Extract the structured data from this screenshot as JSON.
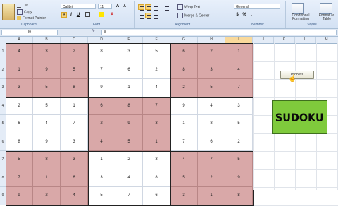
{
  "ribbon": {
    "clipboard": {
      "cut": "Cut",
      "copy": "Copy",
      "format_painter": "Format Painter",
      "label": "Clipboard"
    },
    "font": {
      "name": "Calibri",
      "size": "11",
      "label": "Font",
      "bold": "B",
      "italic": "I",
      "underline": "U"
    },
    "alignment": {
      "wrap_text": "Wrap Text",
      "merge_center": "Merge & Center",
      "label": "Alignment"
    },
    "number": {
      "format": "General",
      "label": "Number",
      "currency": "$",
      "percent": "%"
    },
    "styles": {
      "conditional": "Conditional Formatting",
      "format_table": "Format as Table",
      "label": "Styles"
    }
  },
  "formula_bar": {
    "name_box": "I9",
    "fx": "fx",
    "value": "8"
  },
  "columns": [
    "A",
    "B",
    "C",
    "D",
    "E",
    "F",
    "G",
    "H",
    "I",
    "J",
    "K",
    "L",
    "M"
  ],
  "selected_column": "I",
  "rows": [
    "1",
    "2",
    "3",
    "4",
    "5",
    "6",
    "7",
    "8",
    "9"
  ],
  "grid": [
    [
      "4",
      "3",
      "2",
      "8",
      "3",
      "5",
      "6",
      "2",
      "1"
    ],
    [
      "1",
      "9",
      "5",
      "7",
      "6",
      "2",
      "8",
      "3",
      "4"
    ],
    [
      "3",
      "5",
      "8",
      "9",
      "1",
      "4",
      "2",
      "5",
      "7"
    ],
    [
      "2",
      "5",
      "1",
      "6",
      "8",
      "7",
      "9",
      "4",
      "3"
    ],
    [
      "6",
      "4",
      "7",
      "2",
      "9",
      "3",
      "1",
      "8",
      "5"
    ],
    [
      "8",
      "9",
      "3",
      "4",
      "5",
      "1",
      "7",
      "6",
      "2"
    ],
    [
      "5",
      "8",
      "3",
      "1",
      "2",
      "3",
      "4",
      "7",
      "5"
    ],
    [
      "7",
      "1",
      "6",
      "3",
      "4",
      "8",
      "5",
      "2",
      "9"
    ],
    [
      "9",
      "2",
      "4",
      "5",
      "7",
      "6",
      "3",
      "1",
      "8"
    ]
  ],
  "process_button": "Process",
  "banner": "SUDOKU",
  "colors": {
    "pink": "#d9a8a8",
    "banner": "#7fca3c"
  }
}
